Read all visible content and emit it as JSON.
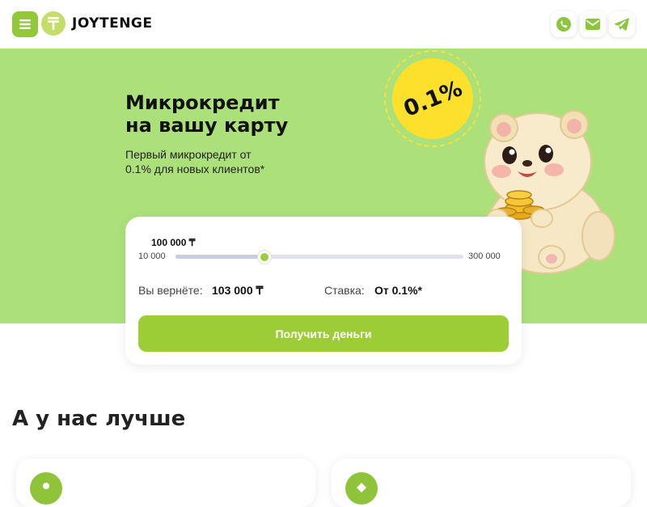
{
  "header": {
    "brand": "JOYTENGE",
    "icons": {
      "menu": "menu-icon",
      "logo": "tenge-icon",
      "phone": "phone-icon",
      "mail": "mail-icon",
      "telegram": "telegram-icon"
    }
  },
  "hero": {
    "title_line1": "Микрокредит",
    "title_line2": "на вашу карту",
    "subtitle": "Первый микрокредит от 0.1% для новых клиентов*",
    "badge": "0.1%"
  },
  "calculator": {
    "amount": "100 000 ₸",
    "min_label": "10 000",
    "max_label": "300 000",
    "slider": {
      "min": 10000,
      "max": 300000,
      "value": 100000
    },
    "return_label": "Вы вернёте:",
    "return_value": "103 000 ₸",
    "rate_label": "Ставка:",
    "rate_value": "От 0.1%*",
    "button_label": "Получить деньги"
  },
  "section": {
    "title": "А у нас лучше"
  },
  "colors": {
    "accent": "#9ccc36",
    "hero_bg": "#abe07a",
    "badge": "#fce02b"
  }
}
